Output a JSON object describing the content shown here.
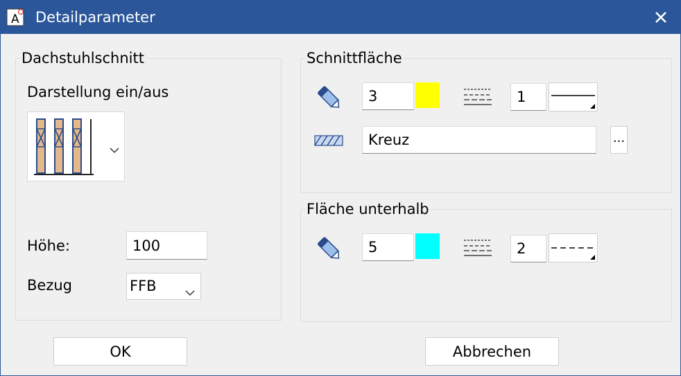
{
  "window": {
    "title": "Detailparameter"
  },
  "left_group": {
    "title": "Dachstuhlschnitt",
    "display_label": "Darstellung ein/aus",
    "height_label": "Höhe:",
    "height_value": "100",
    "reference_label": "Bezug",
    "reference_value": "FFB"
  },
  "section_surface": {
    "title": "Schnittfläche",
    "pen_value": "3",
    "pen_color": "#ffff00",
    "line_value": "1",
    "hatch_value": "Kreuz",
    "browse_label": "..."
  },
  "surface_below": {
    "title": "Fläche unterhalb",
    "pen_value": "5",
    "pen_color": "#00ffff",
    "line_value": "2"
  },
  "buttons": {
    "ok": "OK",
    "cancel": "Abbrechen"
  },
  "icons": [
    "app-icon",
    "close-icon",
    "rafter-preview-icon",
    "chevron-down-icon",
    "pen-icon",
    "line-type-icon",
    "hatch-icon"
  ]
}
